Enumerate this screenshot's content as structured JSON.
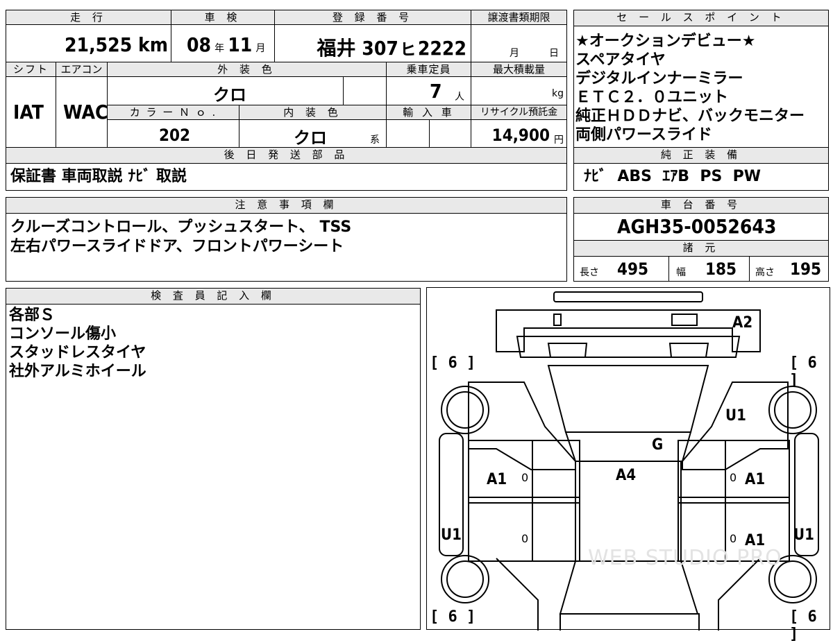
{
  "top": {
    "h_mileage": "走 行",
    "mileage": "21,525 km",
    "h_inspection": "車 検",
    "insp_year": "08",
    "insp_year_unit": "年",
    "insp_month": "11",
    "insp_month_unit": "月",
    "h_reg": "登 録 番 号",
    "reg_number": "福井 307ㇶ2222",
    "h_transfer": "譲渡書類期限",
    "transfer_month": "月",
    "transfer_day": "日",
    "h_shift": "シフト",
    "h_ac": "エアコン",
    "h_ext_color": "外 装 色",
    "h_capacity": "乗車定員",
    "h_maxload": "最大積載量",
    "shift": "IAT",
    "ac": "WAC",
    "ext_color": "クロ",
    "capacity": "7",
    "capacity_unit": "人",
    "maxload_unit": "kg",
    "h_color_no": "カ ラ ー Ｎ ｏ .",
    "h_int_color": "内 装 色",
    "h_import": "輸 入 車",
    "h_recycle": "リサイクル預託金",
    "color_no": "202",
    "int_color": "クロ",
    "int_color_suffix": "系",
    "recycle": "14,900",
    "recycle_unit": "円",
    "h_later": "後 日 発 送 部 品",
    "later_items": "保証書 車両取説 ﾅﾋﾞ 取説"
  },
  "sales": {
    "header": "セ ー ル ス ポ イ ン ト",
    "lines": [
      "★オークションデビュー★",
      "スペアタイヤ",
      "デジタルインナーミラー",
      "ＥＴＣ２．０ユニット",
      "純正ＨＤＤナビ、バックモニター",
      "両側パワースライド"
    ]
  },
  "equipment": {
    "header": "純 正 装 備",
    "items": "ﾅﾋﾞ  ABS  ｴｱB  PS  PW"
  },
  "notes": {
    "header": "注 意 事 項 欄",
    "line1": "クルーズコントロール、プッシュスタート、 TSS",
    "line2": "左右パワースライドドア、フロントパワーシート"
  },
  "chassis": {
    "header": "車 台 番 号",
    "number": "AGH35-0052643",
    "spec_header": "諸 元",
    "len_label": "長さ",
    "len": "495",
    "wid_label": "幅",
    "wid": "185",
    "hei_label": "高さ",
    "hei": "195"
  },
  "inspector": {
    "header": "検 査 員 記 入 欄",
    "lines": [
      "各部Ｓ",
      "コンソール傷小",
      "スタッドレスタイヤ",
      "社外アルミホイール"
    ]
  },
  "diagram": {
    "tires": [
      "[ 6 ]",
      "[ 6 ]",
      "[ 6 ]",
      "[ 6 ]"
    ],
    "codes": {
      "a2": "A2",
      "u1_rf": "U1",
      "g": "G",
      "a4": "A4",
      "a1_lf": "A1",
      "a1_rf": "A1",
      "a1_rr": "A1",
      "u1_l": "U1",
      "u1_r": "U1"
    },
    "zeros": [
      "0",
      "0",
      "0",
      "0"
    ],
    "watermark": "WEB STUDIO PRO"
  }
}
